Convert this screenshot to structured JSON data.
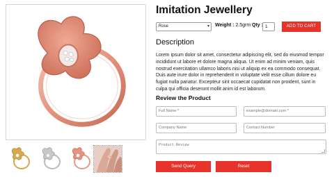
{
  "product": {
    "title": "Imitation Jewellery",
    "material_selected": "Rose",
    "weight_label": "Weight :",
    "weight_value": "2.5grm",
    "qty_label": "Qty :",
    "qty_value": "1",
    "add_to_cart_label": "ADD TO CART"
  },
  "description": {
    "heading": "Description",
    "text": "Lorem ipsum dolor sit amet, consectetur adipiscing elit, sed do eiusmod tempor incididunt ut labore et dolore magna aliqua. Ut enim ad minim veniam, quis nostrud exercitation ullamco laboris nisi ut aliquip ex ea commodo consequat. Duis aute irure dolor in reprehenderit in voluptate velit esse cillum dolore eu fugiat nulla pariatur. Excepteur sint occaecat cupidatat non proident, sunt in culpa qui officia deserunt mollit anim id est laborum."
  },
  "review_form": {
    "heading": "Review the Product",
    "full_name_placeholder": "Full Name *",
    "email_placeholder": "example@domain.com *",
    "company_placeholder": "Company Name",
    "contact_placeholder": "Contact Number",
    "review_placeholder": "Product Review",
    "send_label": "Send Query",
    "reset_label": "Reset"
  },
  "gallery": {
    "thumbnails": [
      "gold-ring",
      "silver-ring",
      "rose-gold-ring",
      "ring-on-hand"
    ]
  },
  "colors": {
    "accent": "#e8332b",
    "rose_gold": "#e49a86"
  }
}
